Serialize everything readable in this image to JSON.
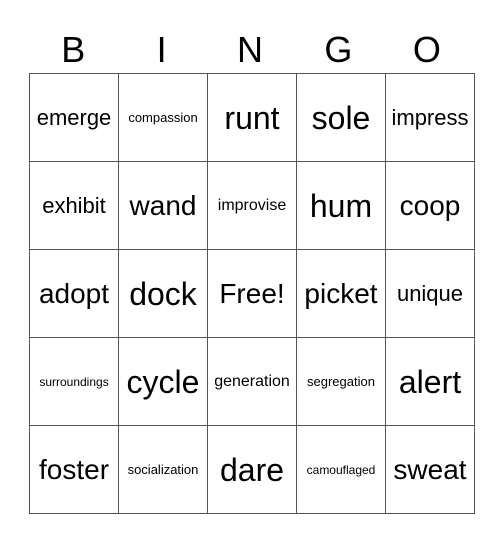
{
  "header": [
    "B",
    "I",
    "N",
    "G",
    "O"
  ],
  "rows": [
    [
      {
        "text": "emerge",
        "size": "m"
      },
      {
        "text": "compassion",
        "size": "xs"
      },
      {
        "text": "runt",
        "size": "xl"
      },
      {
        "text": "sole",
        "size": "xl"
      },
      {
        "text": "impress",
        "size": "m"
      }
    ],
    [
      {
        "text": "exhibit",
        "size": "m"
      },
      {
        "text": "wand",
        "size": "l"
      },
      {
        "text": "improvise",
        "size": "s"
      },
      {
        "text": "hum",
        "size": "xl"
      },
      {
        "text": "coop",
        "size": "l"
      }
    ],
    [
      {
        "text": "adopt",
        "size": "l"
      },
      {
        "text": "dock",
        "size": "xl"
      },
      {
        "text": "Free!",
        "size": "l"
      },
      {
        "text": "picket",
        "size": "l"
      },
      {
        "text": "unique",
        "size": "m"
      }
    ],
    [
      {
        "text": "surroundings",
        "size": "xxs"
      },
      {
        "text": "cycle",
        "size": "xl"
      },
      {
        "text": "generation",
        "size": "s"
      },
      {
        "text": "segregation",
        "size": "xs"
      },
      {
        "text": "alert",
        "size": "xl"
      }
    ],
    [
      {
        "text": "foster",
        "size": "l"
      },
      {
        "text": "socialization",
        "size": "xs"
      },
      {
        "text": "dare",
        "size": "xl"
      },
      {
        "text": "camouflaged",
        "size": "xxs"
      },
      {
        "text": "sweat",
        "size": "l"
      }
    ]
  ]
}
